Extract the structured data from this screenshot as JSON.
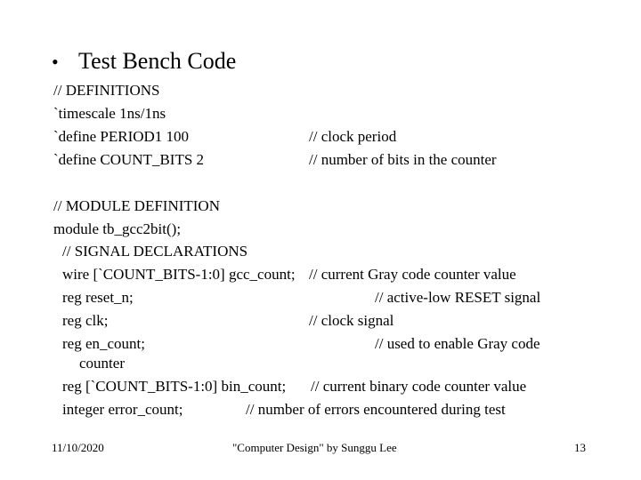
{
  "slide": {
    "bullet_glyph": "•",
    "title": "Test Bench Code",
    "code": {
      "definitions_header": "// DEFINITIONS",
      "timescale": "`timescale 1ns/1ns",
      "define_period": "`define PERIOD1 100",
      "define_period_comment": "// clock period",
      "define_count_bits": "`define COUNT_BITS 2",
      "define_count_bits_comment": "// number of bits in the counter",
      "module_header": "// MODULE DEFINITION",
      "module_decl": "module tb_gcc2bit();",
      "signal_header": "// SIGNAL DECLARATIONS",
      "wire_gcc_count": "wire [`COUNT_BITS-1:0] gcc_count;",
      "wire_gcc_count_comment": "// current Gray code counter value",
      "reg_reset_n": "reg reset_n;",
      "reg_reset_n_comment": "// active-low RESET signal",
      "reg_clk": "reg clk;",
      "reg_clk_comment": "// clock signal",
      "reg_en_count": "reg en_count;",
      "reg_en_count_comment": "// used to enable Gray code",
      "reg_en_count_comment_cont": "counter",
      "reg_bin_count": "reg [`COUNT_BITS-1:0] bin_count;",
      "reg_bin_count_comment": "// current binary code counter value",
      "integer_error_count": "integer error_count;",
      "integer_error_count_comment": "// number of errors encountered during test"
    },
    "footer": {
      "date": "11/10/2020",
      "center": "\"Computer Design\" by Sunggu Lee",
      "page_number": "13"
    }
  }
}
